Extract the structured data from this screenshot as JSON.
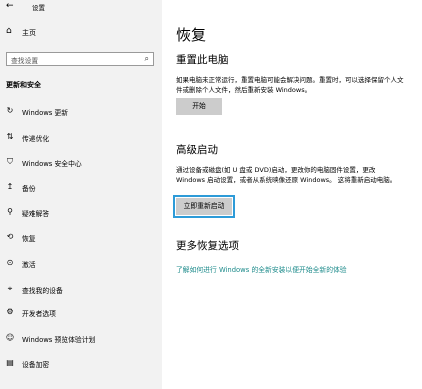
{
  "window": {
    "title": "设置",
    "back_icon": "back-arrow-icon"
  },
  "sidebar": {
    "home": {
      "label": "主页",
      "icon": "home-icon"
    },
    "search": {
      "placeholder": "查找设置",
      "icon": "search-icon"
    },
    "section_title": "更新和安全",
    "items": [
      {
        "label": "Windows 更新",
        "icon": "refresh-icon"
      },
      {
        "label": "传递优化",
        "icon": "delivery-optimization-icon"
      },
      {
        "label": "Windows 安全中心",
        "icon": "shield-icon"
      },
      {
        "label": "备份",
        "icon": "backup-icon"
      },
      {
        "label": "疑难解答",
        "icon": "wrench-icon"
      },
      {
        "label": "恢复",
        "icon": "recovery-icon"
      },
      {
        "label": "激活",
        "icon": "activation-icon"
      },
      {
        "label": "查找我的设备",
        "icon": "find-device-icon"
      },
      {
        "label": "开发者选项",
        "icon": "developer-icon"
      },
      {
        "label": "Windows 预览体验计划",
        "icon": "insider-icon"
      },
      {
        "label": "设备加密",
        "icon": "lock-icon"
      }
    ]
  },
  "main": {
    "title": "恢复",
    "reset": {
      "heading": "重置此电脑",
      "description": "如果电脑未正常运行，重置电脑可能会解决问题。重置时，可以选择保留个人文件或删除个人文件，然后重新安装 Windows。",
      "button": "开始"
    },
    "advanced": {
      "heading": "高级启动",
      "description": "通过设备或磁盘(如 U 盘或 DVD)启动，更改你的电脑固件设置，更改 Windows 启动设置，或者从系统映像还原 Windows。 这将重新启动电脑。",
      "button": "立即重新启动"
    },
    "more": {
      "heading": "更多恢复选项",
      "link": "了解如何进行 Windows 的全新安装以便开始全新的体验"
    }
  }
}
